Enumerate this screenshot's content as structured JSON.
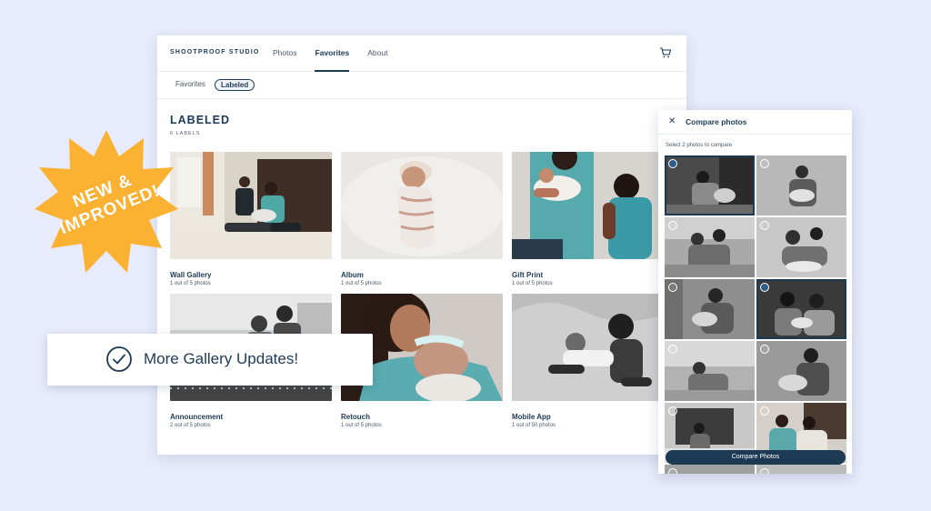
{
  "app": {
    "brand": "SHOOTPROOF STUDIO",
    "nav": [
      "Photos",
      "Favorites",
      "About"
    ],
    "active_nav": "Favorites"
  },
  "subnav": {
    "favorites": "Favorites",
    "labeled": "Labeled"
  },
  "page": {
    "title": "LABELED",
    "subtitle": "6 LABELS"
  },
  "cards": [
    {
      "title": "Wall Gallery",
      "sub": "1 out of 5 photos"
    },
    {
      "title": "Album",
      "sub": "1 out of 5 photos"
    },
    {
      "title": "Gift Print",
      "sub": "1 out of 5 photos"
    },
    {
      "title": "Announcement",
      "sub": "2 out of 5 photos"
    },
    {
      "title": "Retouch",
      "sub": "1 out of 5 photos"
    },
    {
      "title": "Mobile App",
      "sub": "1 out of 50 photos"
    }
  ],
  "compare": {
    "title": "Compare photos",
    "hint": "Select 2 photos to compare",
    "button": "Compare Photos",
    "selected": [
      0,
      3
    ]
  },
  "badge": {
    "line1": "NEW &",
    "line2": "IMPROVED!"
  },
  "banner": {
    "text": "More Gallery Updates!"
  },
  "colors": {
    "accent": "#1d3a55",
    "badge": "#fbb233",
    "background": "#e7ebfb"
  }
}
